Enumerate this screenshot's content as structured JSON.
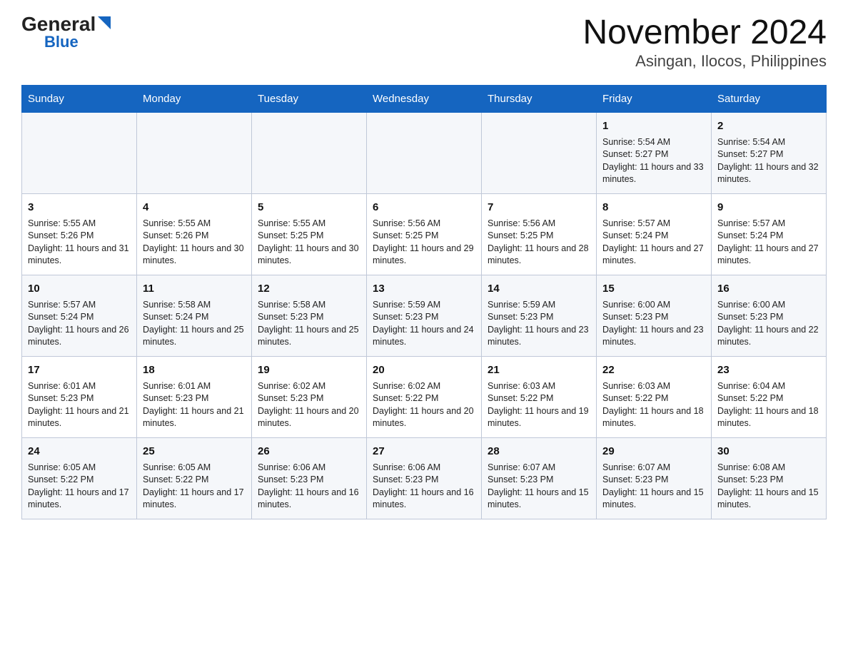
{
  "header": {
    "logo_general": "General",
    "logo_blue": "Blue",
    "title": "November 2024",
    "subtitle": "Asingan, Ilocos, Philippines"
  },
  "days_of_week": [
    "Sunday",
    "Monday",
    "Tuesday",
    "Wednesday",
    "Thursday",
    "Friday",
    "Saturday"
  ],
  "weeks": [
    [
      null,
      null,
      null,
      null,
      null,
      {
        "num": "1",
        "sunrise": "Sunrise: 5:54 AM",
        "sunset": "Sunset: 5:27 PM",
        "daylight": "Daylight: 11 hours and 33 minutes."
      },
      {
        "num": "2",
        "sunrise": "Sunrise: 5:54 AM",
        "sunset": "Sunset: 5:27 PM",
        "daylight": "Daylight: 11 hours and 32 minutes."
      }
    ],
    [
      {
        "num": "3",
        "sunrise": "Sunrise: 5:55 AM",
        "sunset": "Sunset: 5:26 PM",
        "daylight": "Daylight: 11 hours and 31 minutes."
      },
      {
        "num": "4",
        "sunrise": "Sunrise: 5:55 AM",
        "sunset": "Sunset: 5:26 PM",
        "daylight": "Daylight: 11 hours and 30 minutes."
      },
      {
        "num": "5",
        "sunrise": "Sunrise: 5:55 AM",
        "sunset": "Sunset: 5:25 PM",
        "daylight": "Daylight: 11 hours and 30 minutes."
      },
      {
        "num": "6",
        "sunrise": "Sunrise: 5:56 AM",
        "sunset": "Sunset: 5:25 PM",
        "daylight": "Daylight: 11 hours and 29 minutes."
      },
      {
        "num": "7",
        "sunrise": "Sunrise: 5:56 AM",
        "sunset": "Sunset: 5:25 PM",
        "daylight": "Daylight: 11 hours and 28 minutes."
      },
      {
        "num": "8",
        "sunrise": "Sunrise: 5:57 AM",
        "sunset": "Sunset: 5:24 PM",
        "daylight": "Daylight: 11 hours and 27 minutes."
      },
      {
        "num": "9",
        "sunrise": "Sunrise: 5:57 AM",
        "sunset": "Sunset: 5:24 PM",
        "daylight": "Daylight: 11 hours and 27 minutes."
      }
    ],
    [
      {
        "num": "10",
        "sunrise": "Sunrise: 5:57 AM",
        "sunset": "Sunset: 5:24 PM",
        "daylight": "Daylight: 11 hours and 26 minutes."
      },
      {
        "num": "11",
        "sunrise": "Sunrise: 5:58 AM",
        "sunset": "Sunset: 5:24 PM",
        "daylight": "Daylight: 11 hours and 25 minutes."
      },
      {
        "num": "12",
        "sunrise": "Sunrise: 5:58 AM",
        "sunset": "Sunset: 5:23 PM",
        "daylight": "Daylight: 11 hours and 25 minutes."
      },
      {
        "num": "13",
        "sunrise": "Sunrise: 5:59 AM",
        "sunset": "Sunset: 5:23 PM",
        "daylight": "Daylight: 11 hours and 24 minutes."
      },
      {
        "num": "14",
        "sunrise": "Sunrise: 5:59 AM",
        "sunset": "Sunset: 5:23 PM",
        "daylight": "Daylight: 11 hours and 23 minutes."
      },
      {
        "num": "15",
        "sunrise": "Sunrise: 6:00 AM",
        "sunset": "Sunset: 5:23 PM",
        "daylight": "Daylight: 11 hours and 23 minutes."
      },
      {
        "num": "16",
        "sunrise": "Sunrise: 6:00 AM",
        "sunset": "Sunset: 5:23 PM",
        "daylight": "Daylight: 11 hours and 22 minutes."
      }
    ],
    [
      {
        "num": "17",
        "sunrise": "Sunrise: 6:01 AM",
        "sunset": "Sunset: 5:23 PM",
        "daylight": "Daylight: 11 hours and 21 minutes."
      },
      {
        "num": "18",
        "sunrise": "Sunrise: 6:01 AM",
        "sunset": "Sunset: 5:23 PM",
        "daylight": "Daylight: 11 hours and 21 minutes."
      },
      {
        "num": "19",
        "sunrise": "Sunrise: 6:02 AM",
        "sunset": "Sunset: 5:23 PM",
        "daylight": "Daylight: 11 hours and 20 minutes."
      },
      {
        "num": "20",
        "sunrise": "Sunrise: 6:02 AM",
        "sunset": "Sunset: 5:22 PM",
        "daylight": "Daylight: 11 hours and 20 minutes."
      },
      {
        "num": "21",
        "sunrise": "Sunrise: 6:03 AM",
        "sunset": "Sunset: 5:22 PM",
        "daylight": "Daylight: 11 hours and 19 minutes."
      },
      {
        "num": "22",
        "sunrise": "Sunrise: 6:03 AM",
        "sunset": "Sunset: 5:22 PM",
        "daylight": "Daylight: 11 hours and 18 minutes."
      },
      {
        "num": "23",
        "sunrise": "Sunrise: 6:04 AM",
        "sunset": "Sunset: 5:22 PM",
        "daylight": "Daylight: 11 hours and 18 minutes."
      }
    ],
    [
      {
        "num": "24",
        "sunrise": "Sunrise: 6:05 AM",
        "sunset": "Sunset: 5:22 PM",
        "daylight": "Daylight: 11 hours and 17 minutes."
      },
      {
        "num": "25",
        "sunrise": "Sunrise: 6:05 AM",
        "sunset": "Sunset: 5:22 PM",
        "daylight": "Daylight: 11 hours and 17 minutes."
      },
      {
        "num": "26",
        "sunrise": "Sunrise: 6:06 AM",
        "sunset": "Sunset: 5:23 PM",
        "daylight": "Daylight: 11 hours and 16 minutes."
      },
      {
        "num": "27",
        "sunrise": "Sunrise: 6:06 AM",
        "sunset": "Sunset: 5:23 PM",
        "daylight": "Daylight: 11 hours and 16 minutes."
      },
      {
        "num": "28",
        "sunrise": "Sunrise: 6:07 AM",
        "sunset": "Sunset: 5:23 PM",
        "daylight": "Daylight: 11 hours and 15 minutes."
      },
      {
        "num": "29",
        "sunrise": "Sunrise: 6:07 AM",
        "sunset": "Sunset: 5:23 PM",
        "daylight": "Daylight: 11 hours and 15 minutes."
      },
      {
        "num": "30",
        "sunrise": "Sunrise: 6:08 AM",
        "sunset": "Sunset: 5:23 PM",
        "daylight": "Daylight: 11 hours and 15 minutes."
      }
    ]
  ]
}
